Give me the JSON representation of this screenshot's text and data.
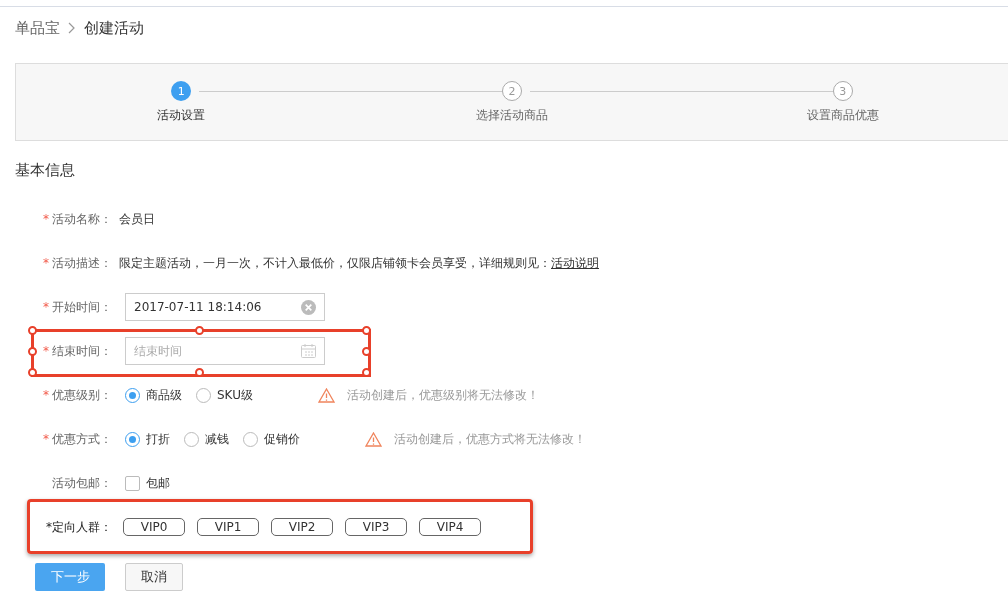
{
  "breadcrumb": [
    {
      "label": "单品宝"
    },
    {
      "label": "创建活动"
    }
  ],
  "steps": [
    {
      "number": "1",
      "label": "活动设置",
      "selected": true
    },
    {
      "number": "2",
      "label": "选择活动商品",
      "selected": false
    },
    {
      "number": "3",
      "label": "设置商品优惠",
      "selected": false
    }
  ],
  "section_title": "基本信息",
  "form": [
    {
      "kind": "text",
      "label": "活动名称：",
      "mark": "*",
      "value": "会员日"
    },
    {
      "kind": "text",
      "label": "活动描述：",
      "mark": "*",
      "value": "限定主题活动，一月一次，不计入最低价，仅限店铺领卡会员享受，详细规则见：",
      "link": "活动说明"
    },
    {
      "kind": "field",
      "label": "开始时间：",
      "mark": "*",
      "value": "2017-07-11 18:14:06"
    },
    {
      "kind": "field",
      "label": "结束时间：",
      "mark": "*",
      "placeholder": "结束时间",
      "highlighted": true,
      "handles": true
    },
    {
      "kind": "radio",
      "label": "优惠级别：",
      "mark": "*",
      "options": [
        {
          "label": "商品级",
          "selected": true
        },
        {
          "label": "SKU级",
          "selected": false
        }
      ],
      "warning": "活动创建后，优惠级别将无法修改！"
    },
    {
      "kind": "radio",
      "label": "优惠方式：",
      "mark": "*",
      "options": [
        {
          "label": "打折",
          "selected": true
        },
        {
          "label": "减钱",
          "selected": false
        },
        {
          "label": "促销价",
          "selected": false
        }
      ],
      "warning": "活动创建后，优惠方式将无法修改！"
    },
    {
      "kind": "checkbox",
      "label": "活动包邮：",
      "option": "包邮",
      "checked": false
    },
    {
      "kind": "tags",
      "label": "*定向人群：",
      "tags": [
        "VIP0",
        "VIP1",
        "VIP2",
        "VIP3",
        "VIP4"
      ],
      "highlighted": true,
      "handles": false
    }
  ],
  "buttons": [
    {
      "label": "下一步",
      "kind": "primary"
    },
    {
      "label": "取消",
      "kind": "default"
    }
  ]
}
